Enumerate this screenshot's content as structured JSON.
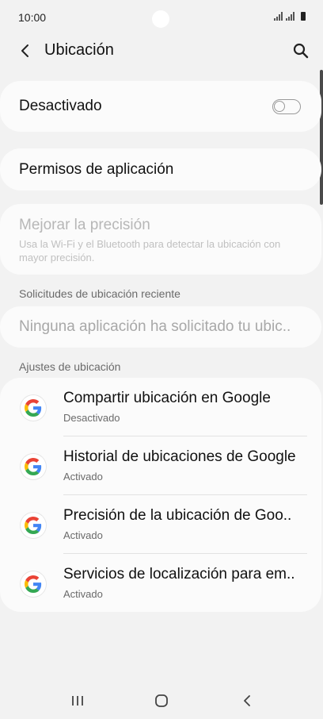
{
  "status_bar": {
    "time": "10:00"
  },
  "app_bar": {
    "title": "Ubicación"
  },
  "main_toggle": {
    "label": "Desactivado",
    "state": "off"
  },
  "permissions": {
    "label": "Permisos de aplicación"
  },
  "improve_accuracy": {
    "title": "Mejorar la precisión",
    "subtitle": "Usa la Wi-Fi y el Bluetooth para detectar la ubicación con mayor precisión."
  },
  "recent_requests": {
    "header": "Solicitudes de ubicación reciente",
    "empty_text": "Ninguna aplicación ha solicitado tu ubic.."
  },
  "location_settings": {
    "header": "Ajustes de ubicación",
    "items": [
      {
        "title": "Compartir ubicación en Google",
        "status": "Desactivado",
        "icon": "google-icon"
      },
      {
        "title": "Historial de ubicaciones de Google",
        "status": "Activado",
        "icon": "google-icon"
      },
      {
        "title": "Precisión de la ubicación de Goo..",
        "status": "Activado",
        "icon": "google-icon"
      },
      {
        "title": "Servicios de localización para em..",
        "status": "Activado",
        "icon": "google-icon"
      }
    ]
  },
  "colors": {
    "background": "#f2f2f2",
    "card": "#fbfbfb",
    "google_blue": "#4285F4",
    "google_red": "#EA4335",
    "google_yellow": "#FBBC05",
    "google_green": "#34A853"
  }
}
